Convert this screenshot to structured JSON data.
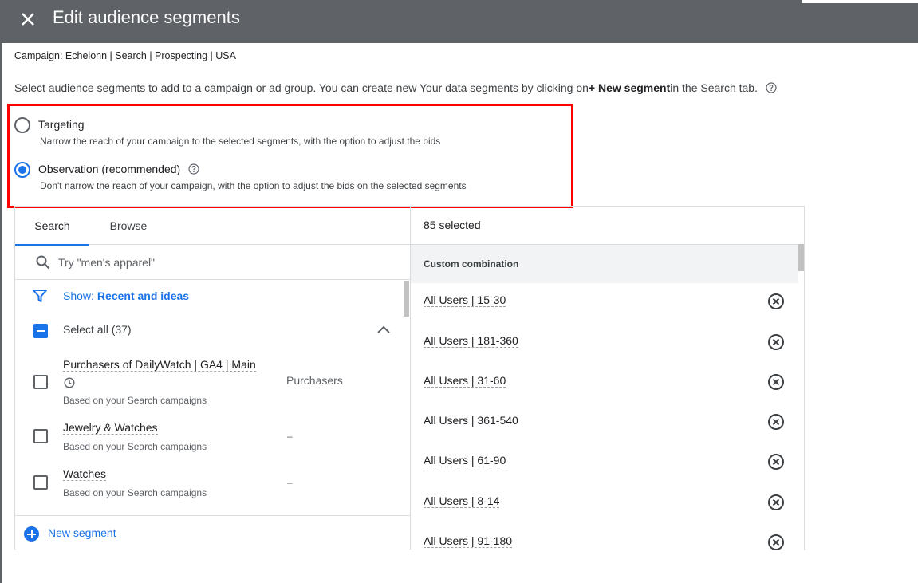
{
  "header": {
    "title": "Edit audience segments",
    "close_icon": "close-icon"
  },
  "campaign_line": "Campaign: Echelonn | Search | Prospecting | USA",
  "instructions": {
    "before": "Select audience segments to add to a campaign or ad group. You can create new Your data segments by clicking on ",
    "bold": "+ New segment",
    "after": " in the Search tab."
  },
  "mode": {
    "selected": "observation",
    "targeting": {
      "label": "Targeting",
      "description": "Narrow the reach of your campaign to the selected segments, with the option to adjust the bids"
    },
    "observation": {
      "label": "Observation (recommended)",
      "description": "Don't narrow the reach of your campaign, with the option to adjust the bids on the selected segments"
    }
  },
  "tabs": {
    "search": "Search",
    "browse": "Browse",
    "active": "search"
  },
  "search": {
    "placeholder": "Try \"men's apparel\""
  },
  "filter": {
    "label": "Show:",
    "value": "Recent and ideas"
  },
  "select_all": {
    "label": "Select all (37)"
  },
  "segments": [
    {
      "title": "Purchasers of DailyWatch | GA4 | Main",
      "subtitle": "Based on your Search campaigns",
      "column": "Purchasers",
      "icon": "clock-icon"
    },
    {
      "title": "Jewelry & Watches",
      "subtitle": "Based on your Search campaigns",
      "column": "–"
    },
    {
      "title": "Watches",
      "subtitle": "Based on your Search campaigns",
      "column": "–"
    }
  ],
  "new_segment": {
    "label": "New segment"
  },
  "selected_panel": {
    "count_label": "85 selected",
    "group_header": "Custom combination",
    "items": [
      "All Users | 15-30",
      "All Users | 181-360",
      "All Users | 31-60",
      "All Users | 361-540",
      "All Users | 61-90",
      "All Users | 8-14",
      "All Users | 91-180"
    ]
  },
  "colors": {
    "header_bg": "#5f6368",
    "accent": "#1a73e8",
    "highlight_box": "#ff0000"
  }
}
